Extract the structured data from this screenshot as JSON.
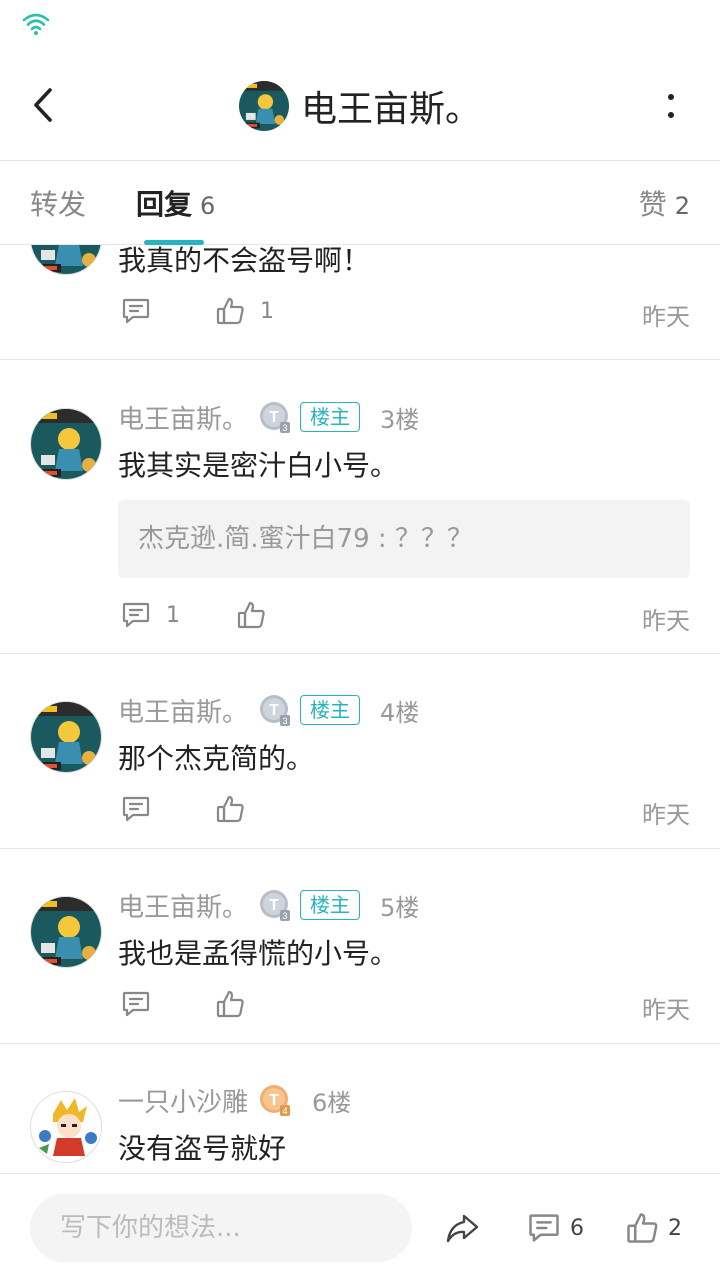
{
  "header": {
    "title": "电王亩斯。"
  },
  "tabs": [
    {
      "label": "转发",
      "count": ""
    },
    {
      "label": "回复",
      "count": "6"
    },
    {
      "label": "赞",
      "count": "2"
    }
  ],
  "colors": {
    "accent": "#27b4c0",
    "muted_text": "#999999",
    "divider": "#e8e8e8"
  },
  "replies": [
    {
      "content": "我真的不会盗号啊！",
      "comment_count": "",
      "like_count": "1",
      "time": "昨天"
    },
    {
      "username": "电王亩斯。",
      "badge": "楼主",
      "floor": "3楼",
      "content": "我其实是密汁白小号。",
      "quote": "杰克逊.简.蜜汁白79 : ？？？",
      "comment_count": "1",
      "like_count": "",
      "time": "昨天"
    },
    {
      "username": "电王亩斯。",
      "badge": "楼主",
      "floor": "4楼",
      "content": "那个杰克简的。",
      "comment_count": "",
      "like_count": "",
      "time": "昨天"
    },
    {
      "username": "电王亩斯。",
      "badge": "楼主",
      "floor": "5楼",
      "content": "我也是孟得慌的小号。",
      "comment_count": "",
      "like_count": "",
      "time": "昨天"
    },
    {
      "username": "一只小沙雕",
      "floor": "6楼",
      "content": "没有盗号就好"
    }
  ],
  "bottom": {
    "input_placeholder": "写下你的想法...",
    "comment_count": "6",
    "like_count": "2"
  },
  "icons": {
    "status": "wifi-icon",
    "back": "back-arrow-icon",
    "more": "more-vertical-icon",
    "comment": "comment-icon",
    "like": "thumbs-up-icon",
    "share": "share-icon",
    "medal_silver": "silver-t-medal-icon",
    "medal_gold": "gold-t-medal-icon"
  }
}
